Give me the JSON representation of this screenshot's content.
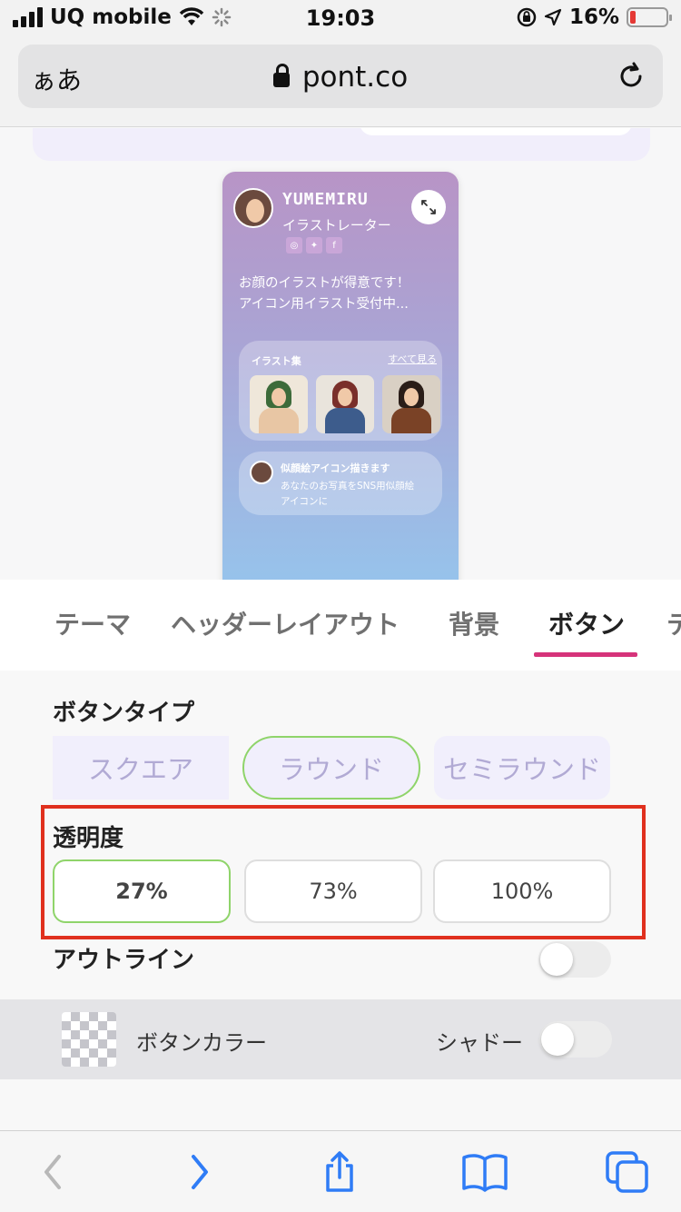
{
  "status_bar": {
    "carrier": "UQ mobile",
    "time": "19:03",
    "battery_percent": "16%",
    "battery_level": 0.16
  },
  "browser": {
    "aa_label": "ぁあ",
    "url": "pont.co"
  },
  "preview": {
    "name": "YUMEMIRU",
    "role": "イラストレーター",
    "bio": "お顔のイラストが得意です！\nアイコン用イラスト受付中...",
    "gallery_title": "イラスト集",
    "gallery_see_all": "すべて見る",
    "card_title": "似顔絵アイコン描きます",
    "card_desc": "あなたのお写真をSNS用似顔絵\nアイコンに",
    "gradient_top": "#b894c6",
    "gradient_bottom": "#96c4ec"
  },
  "tabs": [
    {
      "label": "テーマ",
      "active": false
    },
    {
      "label": "ヘッダーレイアウト",
      "active": false
    },
    {
      "label": "背景",
      "active": false
    },
    {
      "label": "ボタン",
      "active": true
    },
    {
      "label": "テ",
      "active": false
    }
  ],
  "settings": {
    "button_type_title": "ボタンタイプ",
    "button_types": [
      "スクエア",
      "ラウンド",
      "セミラウンド"
    ],
    "selected_button_type": "ラウンド",
    "opacity_title": "透明度",
    "opacity_options": [
      "27%",
      "73%",
      "100%"
    ],
    "selected_opacity": "27%",
    "outline_label": "アウトライン",
    "outline_on": false,
    "button_color_label": "ボタンカラー",
    "shadow_label": "シャドー",
    "shadow_on": false
  },
  "colors": {
    "accent_tab": "#d6337a",
    "selected_border": "#8fd46a",
    "highlight_box": "#e0301e",
    "ios_blue": "#2f7cf6"
  },
  "toolbar_icons": [
    "back-icon",
    "forward-icon",
    "share-icon",
    "bookmarks-icon",
    "tabs-icon"
  ]
}
